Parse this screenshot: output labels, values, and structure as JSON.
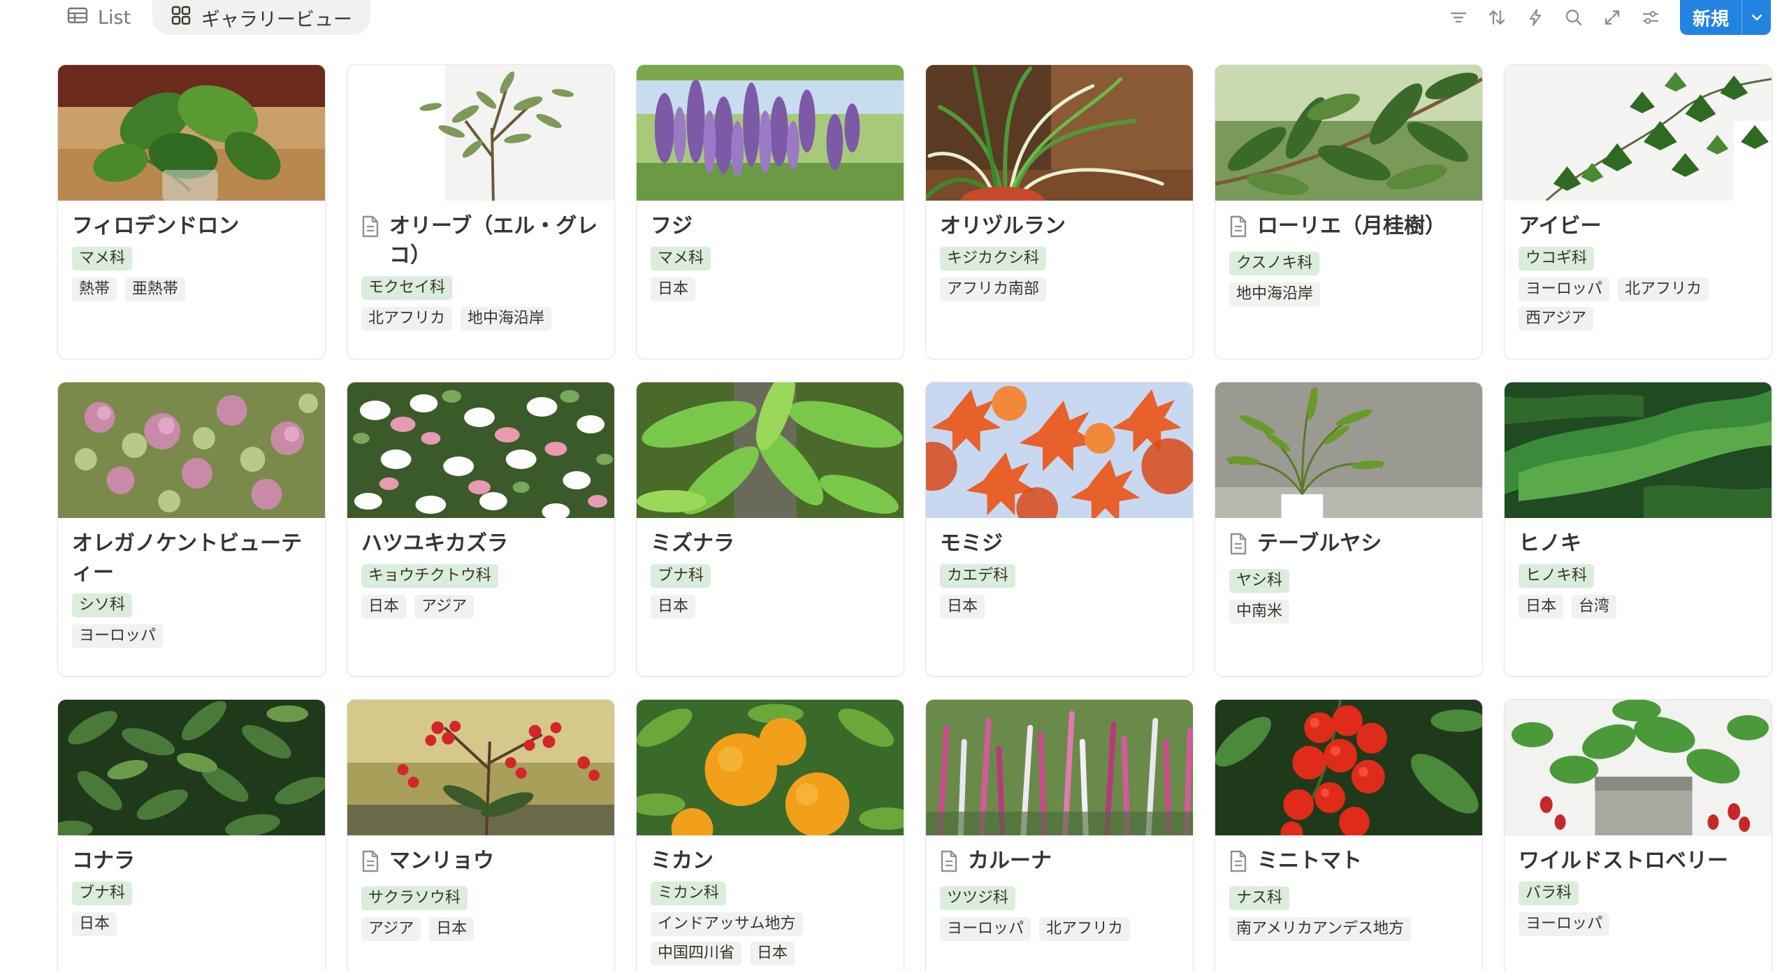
{
  "toolbar": {
    "tabs": [
      {
        "label": "List",
        "icon": "table-icon"
      },
      {
        "label": "ギャラリービュー",
        "icon": "gallery-grid-icon",
        "active": true
      }
    ],
    "icons": [
      "filter-icon",
      "sort-icon",
      "lightning-icon",
      "search-icon",
      "expand-icon",
      "settings-sliders-icon"
    ],
    "new_button": {
      "label": "新規",
      "icon": "chevron-down-icon"
    },
    "accent_color": "#2383e2"
  },
  "tag_colors": {
    "family": "#dbeddb",
    "region": "#f1f1ef"
  },
  "cards": [
    {
      "title": "フィロデンドロン",
      "page_icon": false,
      "family": "マメ科",
      "regions": [
        "熱帯",
        "亜熱帯"
      ],
      "cover": "philodendron"
    },
    {
      "title": "オリーブ（エル・グレコ）",
      "page_icon": true,
      "family": "モクセイ科",
      "regions": [
        "北アフリカ",
        "地中海沿岸"
      ],
      "cover": "olive"
    },
    {
      "title": "フジ",
      "page_icon": false,
      "family": "マメ科",
      "regions": [
        "日本"
      ],
      "cover": "wisteria"
    },
    {
      "title": "オリヅルラン",
      "page_icon": false,
      "family": "キジカクシ科",
      "regions": [
        "アフリカ南部"
      ],
      "cover": "spider-plant"
    },
    {
      "title": "ローリエ（月桂樹）",
      "page_icon": true,
      "family": "クスノキ科",
      "regions": [
        "地中海沿岸"
      ],
      "cover": "laurel"
    },
    {
      "title": "アイビー",
      "page_icon": false,
      "family": "ウコギ科",
      "regions": [
        "ヨーロッパ",
        "北アフリカ",
        "西アジア"
      ],
      "cover": "ivy"
    },
    {
      "title": "オレガノケントビューティー",
      "page_icon": false,
      "family": "シソ科",
      "regions": [
        "ヨーロッパ"
      ],
      "cover": "oregano"
    },
    {
      "title": "ハツユキカズラ",
      "page_icon": false,
      "family": "キョウチクトウ科",
      "regions": [
        "日本",
        "アジア"
      ],
      "cover": "hatsuyuki"
    },
    {
      "title": "ミズナラ",
      "page_icon": false,
      "family": "ブナ科",
      "regions": [
        "日本"
      ],
      "cover": "mizunara"
    },
    {
      "title": "モミジ",
      "page_icon": false,
      "family": "カエデ科",
      "regions": [
        "日本"
      ],
      "cover": "momiji"
    },
    {
      "title": "テーブルヤシ",
      "page_icon": true,
      "family": "ヤシ科",
      "regions": [
        "中南米"
      ],
      "cover": "palm"
    },
    {
      "title": "ヒノキ",
      "page_icon": false,
      "family": "ヒノキ科",
      "regions": [
        "日本",
        "台湾"
      ],
      "cover": "hinoki"
    },
    {
      "title": "コナラ",
      "page_icon": false,
      "family": "ブナ科",
      "regions": [
        "日本"
      ],
      "cover": "konara"
    },
    {
      "title": "マンリョウ",
      "page_icon": true,
      "family": "サクラソウ科",
      "regions": [
        "アジア",
        "日本"
      ],
      "cover": "manryo"
    },
    {
      "title": "ミカン",
      "page_icon": false,
      "family": "ミカン科",
      "regions": [
        "インドアッサム地方",
        "中国四川省",
        "日本"
      ],
      "cover": "mikan"
    },
    {
      "title": "カルーナ",
      "page_icon": true,
      "family": "ツツジ科",
      "regions": [
        "ヨーロッパ",
        "北アフリカ"
      ],
      "cover": "calluna"
    },
    {
      "title": "ミニトマト",
      "page_icon": true,
      "family": "ナス科",
      "regions": [
        "南アメリカアンデス地方"
      ],
      "cover": "tomato"
    },
    {
      "title": "ワイルドストロベリー",
      "page_icon": false,
      "family": "バラ科",
      "regions": [
        "ヨーロッパ"
      ],
      "cover": "strawberry"
    }
  ]
}
